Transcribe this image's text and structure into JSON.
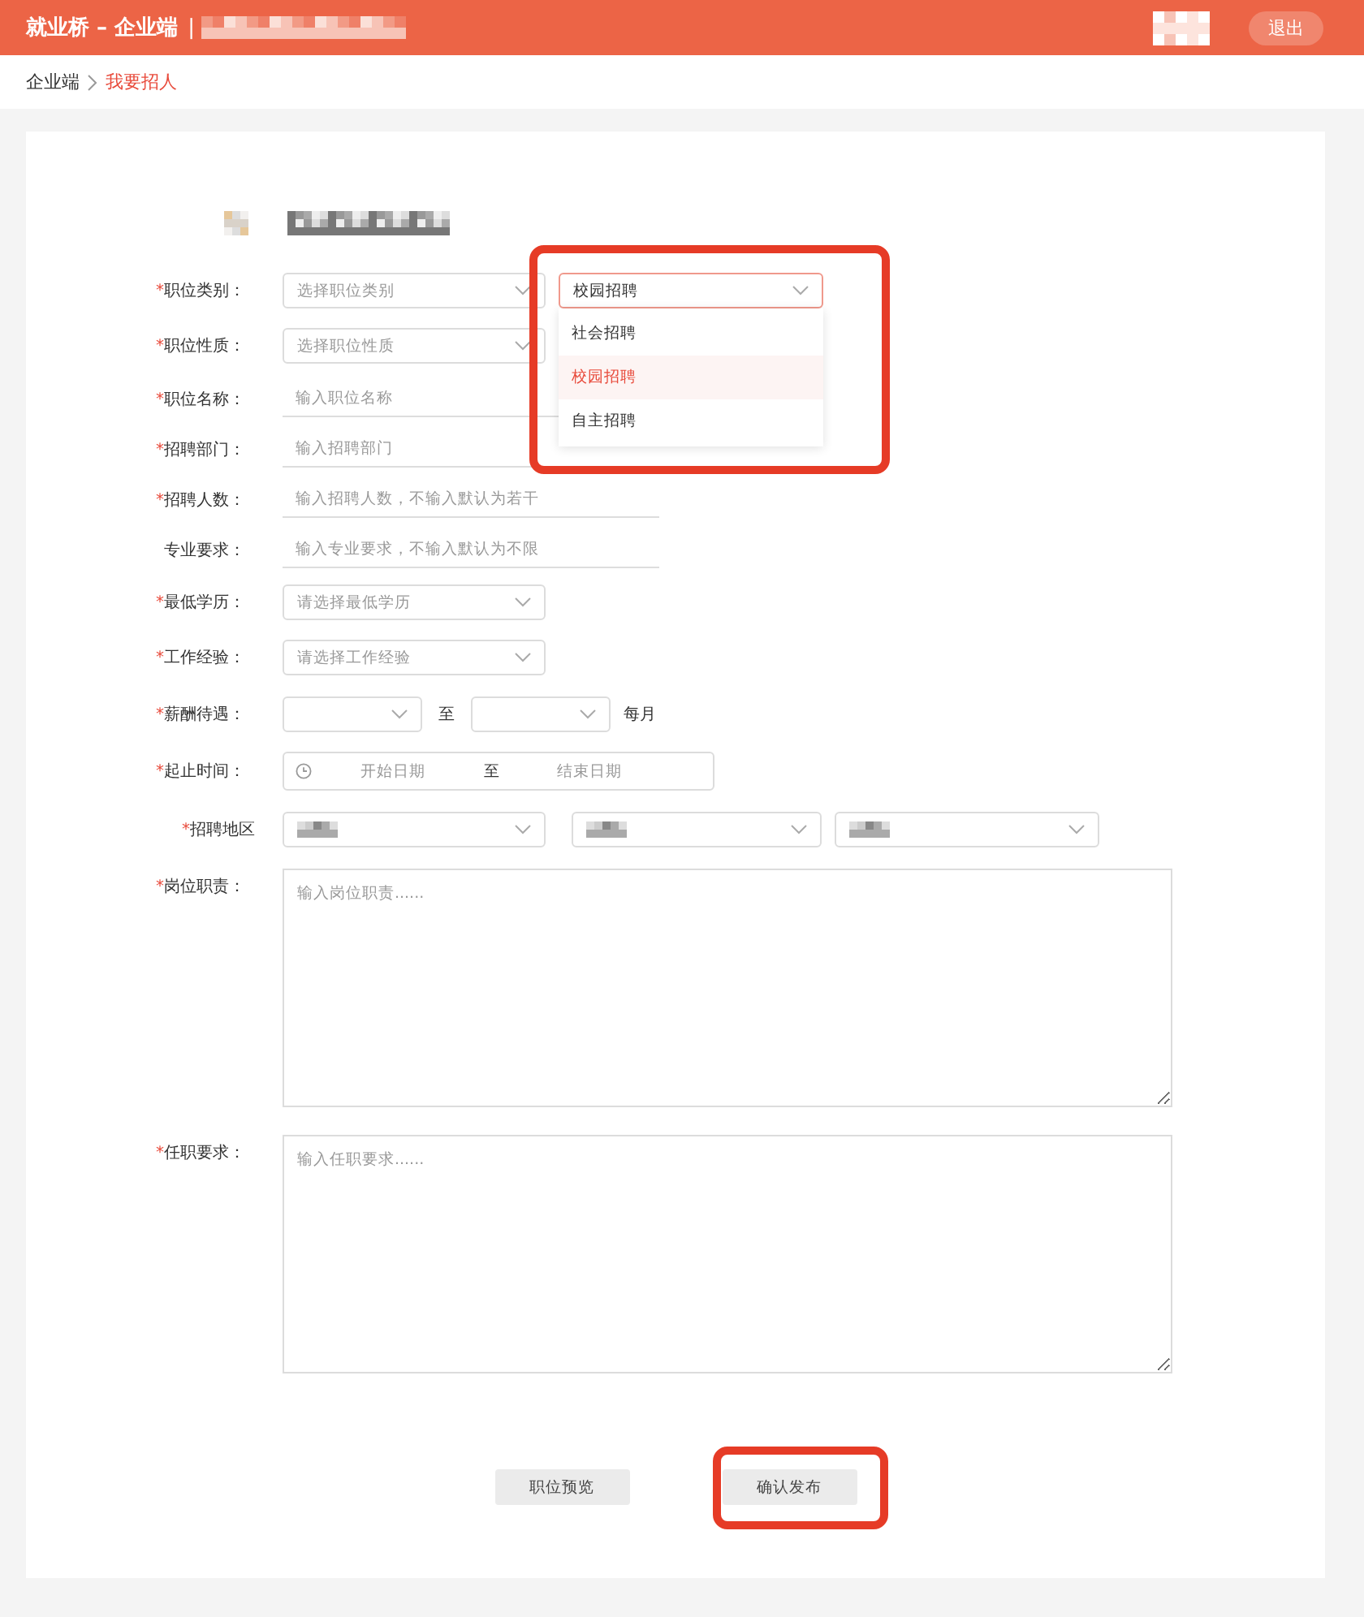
{
  "header": {
    "title": "就业桥 – 企业端",
    "separator": "|",
    "logout": "退出"
  },
  "breadcrumb": [
    {
      "label": "企业端",
      "current": false
    },
    {
      "label": "我要招人",
      "current": true
    }
  ],
  "form": {
    "fields": [
      {
        "kind": "select-pair",
        "required_mark": "*",
        "label": "职位类别：",
        "placeholder": "选择职位类别",
        "value": "校园招聘",
        "expanded": true,
        "highlighted": true,
        "options": [
          {
            "label": "社会招聘",
            "selected": false
          },
          {
            "label": "校园招聘",
            "selected": true
          },
          {
            "label": "自主招聘",
            "selected": false
          }
        ]
      },
      {
        "kind": "select",
        "required_mark": "*",
        "label": "职位性质：",
        "placeholder": "选择职位性质"
      },
      {
        "kind": "text",
        "required_mark": "*",
        "label": "职位名称：",
        "placeholder": "输入职位名称"
      },
      {
        "kind": "text",
        "required_mark": "*",
        "label": "招聘部门：",
        "placeholder": "输入招聘部门"
      },
      {
        "kind": "text",
        "required_mark": "*",
        "label": "招聘人数：",
        "placeholder": "输入招聘人数，不输入默认为若干"
      },
      {
        "kind": "text",
        "label": "专业要求：",
        "placeholder": "输入专业要求，不输入默认为不限"
      },
      {
        "kind": "select",
        "required_mark": "*",
        "label": "最低学历：",
        "placeholder": "请选择最低学历"
      },
      {
        "kind": "select",
        "required_mark": "*",
        "label": "工作经验：",
        "placeholder": "请选择工作经验"
      },
      {
        "kind": "range-select",
        "required_mark": "*",
        "label": "薪酬待遇：",
        "separator": "至",
        "suffix": "每月"
      },
      {
        "kind": "date-range",
        "required_mark": "*",
        "label": "起止时间：",
        "start_placeholder": "开始日期",
        "separator": "至",
        "end_placeholder": "结束日期"
      },
      {
        "kind": "region",
        "required_mark": "*",
        "label": "招聘地区"
      },
      {
        "kind": "textarea",
        "required_mark": "*",
        "label": "岗位职责：",
        "placeholder": "输入岗位职责......"
      },
      {
        "kind": "textarea",
        "required_mark": "*",
        "label": "任职要求：",
        "placeholder": "输入任职要求......"
      }
    ]
  },
  "buttons": [
    {
      "label": "职位预览",
      "highlighted": false
    },
    {
      "label": "确认发布",
      "highlighted": true
    }
  ]
}
